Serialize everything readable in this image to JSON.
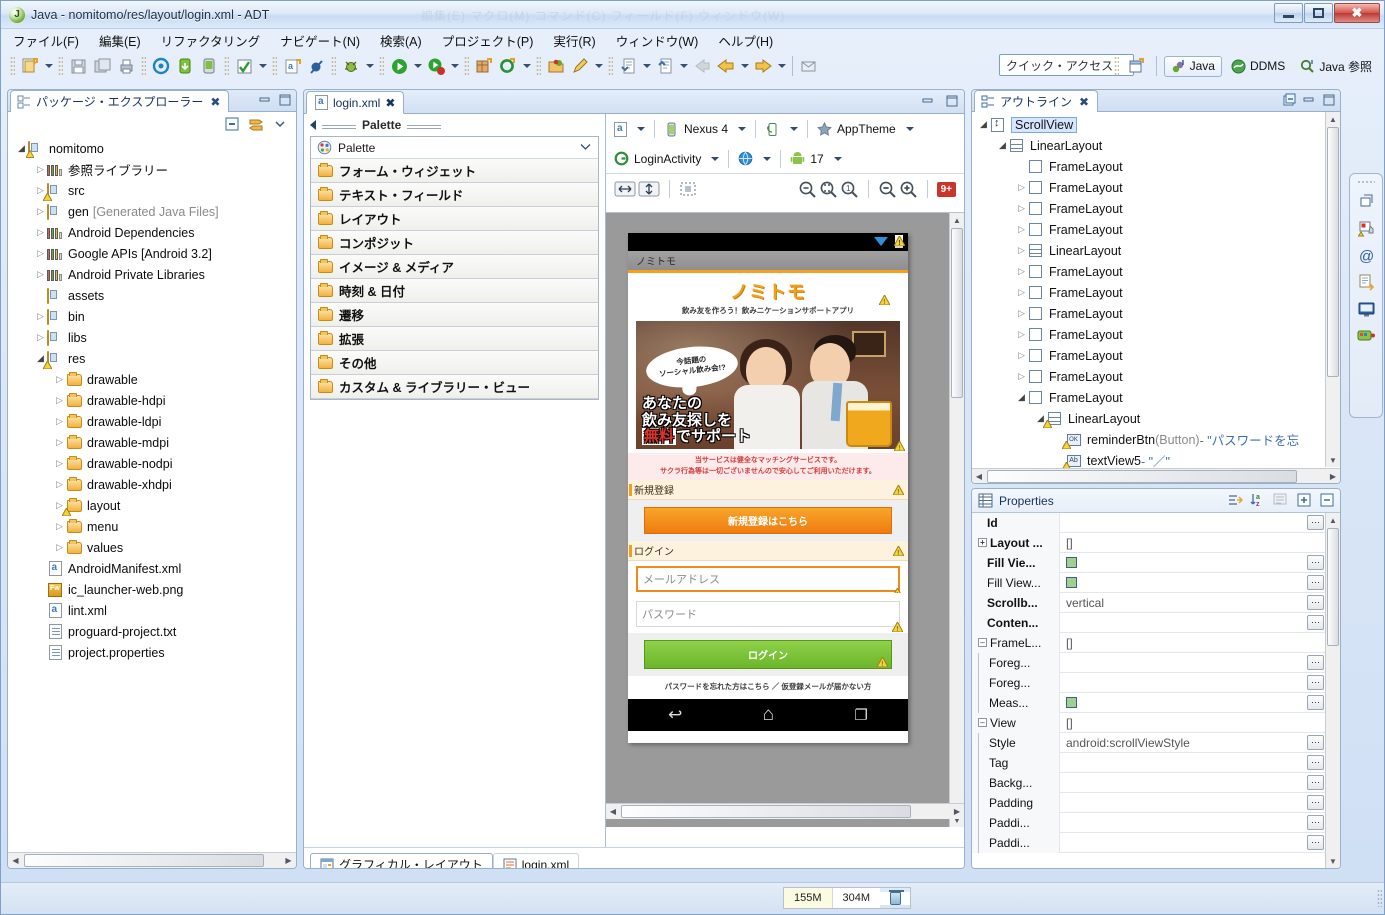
{
  "window": {
    "title": "Java - nomitomo/res/layout/login.xml - ADT",
    "ghost_text": "編集(E)    マクロ(M)    コマンド(C)    フィールド(F)    ウィンドウ(W)",
    "minimize": "–",
    "maximize": "□",
    "close": "✕"
  },
  "menubar": [
    {
      "label": "ファイル(F)"
    },
    {
      "label": "編集(E)"
    },
    {
      "label": "リファクタリング"
    },
    {
      "label": "ナビゲート(N)"
    },
    {
      "label": "検索(A)"
    },
    {
      "label": "プロジェクト(P)"
    },
    {
      "label": "実行(R)"
    },
    {
      "label": "ウィンドウ(W)"
    },
    {
      "label": "ヘルプ(H)"
    }
  ],
  "toolbar": {
    "quick_access_placeholder": "クイック・アクセス",
    "perspectives": [
      {
        "label": "Java",
        "active": true
      },
      {
        "label": "DDMS",
        "active": false
      },
      {
        "label": "Java 参照",
        "active": false
      }
    ]
  },
  "package_explorer": {
    "tab_label": "パッケージ・エクスプローラー",
    "close_glyph": "✖",
    "tree": [
      {
        "depth": 0,
        "label": "nomitomo",
        "icon": "project-icon",
        "twisty": "open",
        "warn": true
      },
      {
        "depth": 1,
        "label": "参照ライブラリー",
        "icon": "library-icon",
        "twisty": "closed"
      },
      {
        "depth": 1,
        "label": "src",
        "icon": "source-folder-icon",
        "twisty": "closed",
        "warn": true
      },
      {
        "depth": 1,
        "label": "gen",
        "suffix": "[Generated Java Files]",
        "icon": "source-folder-icon",
        "twisty": "closed"
      },
      {
        "depth": 1,
        "label": "Android Dependencies",
        "icon": "library-icon",
        "twisty": "closed"
      },
      {
        "depth": 1,
        "label": "Google APIs [Android 3.2]",
        "icon": "library-icon",
        "twisty": "closed"
      },
      {
        "depth": 1,
        "label": "Android Private Libraries",
        "icon": "library-icon",
        "twisty": "closed"
      },
      {
        "depth": 1,
        "label": "assets",
        "icon": "folder-res-icon",
        "twisty": "none"
      },
      {
        "depth": 1,
        "label": "bin",
        "icon": "folder-res-icon",
        "twisty": "closed"
      },
      {
        "depth": 1,
        "label": "libs",
        "icon": "folder-res-icon",
        "twisty": "closed"
      },
      {
        "depth": 1,
        "label": "res",
        "icon": "folder-res-icon",
        "twisty": "open",
        "warn": true
      },
      {
        "depth": 2,
        "label": "drawable",
        "icon": "folder-icon",
        "twisty": "closed"
      },
      {
        "depth": 2,
        "label": "drawable-hdpi",
        "icon": "folder-icon",
        "twisty": "closed"
      },
      {
        "depth": 2,
        "label": "drawable-ldpi",
        "icon": "folder-icon",
        "twisty": "closed"
      },
      {
        "depth": 2,
        "label": "drawable-mdpi",
        "icon": "folder-icon",
        "twisty": "closed"
      },
      {
        "depth": 2,
        "label": "drawable-nodpi",
        "icon": "folder-icon",
        "twisty": "closed"
      },
      {
        "depth": 2,
        "label": "drawable-xhdpi",
        "icon": "folder-icon",
        "twisty": "closed"
      },
      {
        "depth": 2,
        "label": "layout",
        "icon": "folder-icon",
        "twisty": "closed",
        "warn": true
      },
      {
        "depth": 2,
        "label": "menu",
        "icon": "folder-icon",
        "twisty": "closed"
      },
      {
        "depth": 2,
        "label": "values",
        "icon": "folder-icon",
        "twisty": "closed"
      },
      {
        "depth": 1,
        "label": "AndroidManifest.xml",
        "icon": "xml-file-icon",
        "twisty": "none"
      },
      {
        "depth": 1,
        "label": "ic_launcher-web.png",
        "icon": "png-file-icon",
        "twisty": "none"
      },
      {
        "depth": 1,
        "label": "lint.xml",
        "icon": "xml-file-icon",
        "twisty": "none"
      },
      {
        "depth": 1,
        "label": "proguard-project.txt",
        "icon": "text-file-icon",
        "twisty": "none"
      },
      {
        "depth": 1,
        "label": "project.properties",
        "icon": "text-file-icon",
        "twisty": "none"
      }
    ]
  },
  "editor": {
    "tab_label": "login.xml",
    "close_glyph": "✖",
    "palette": {
      "header_title": "Palette",
      "picker_label": "Palette",
      "categories": [
        {
          "label": "フォーム・ウィジェット"
        },
        {
          "label": "テキスト・フィールド"
        },
        {
          "label": "レイアウト"
        },
        {
          "label": "コンポジット"
        },
        {
          "label": "イメージ & メディア"
        },
        {
          "label": "時刻 & 日付"
        },
        {
          "label": "遷移"
        },
        {
          "label": "拡張"
        },
        {
          "label": "その他"
        },
        {
          "label": "カスタム & ライブラリー・ビュー"
        }
      ]
    },
    "config_bar": {
      "device": "Nexus 4",
      "theme": "AppTheme",
      "activity": "LoginActivity",
      "api_level": "17",
      "error_badge": "9+"
    },
    "bottom_tabs": [
      {
        "label": "グラフィカル・レイアウト",
        "active": true
      },
      {
        "label": "login.xml",
        "active": false
      }
    ]
  },
  "device_preview": {
    "app_title": "ノミトモ",
    "logo_text": "ノミトモ",
    "logo_sub": "飲み友を作ろう！飲みニケーションサポートアプリ",
    "hero_bubble": "今話題の\nソーシャル飲み会!?",
    "hero_line1": "あなたの",
    "hero_line2": "飲み友探しを",
    "hero_free": "無料",
    "hero_line3": "でサポート",
    "notice_line1": "当サービスは健全なマッチングサービスです。",
    "notice_line2": "サクラ行為等は一切ございませんので安心してご利用いただけます。",
    "section_register": "新規登録",
    "register_button": "新規登録はこちら",
    "section_login": "ログイン",
    "email_placeholder": "メールアドレス",
    "password_placeholder": "パスワード",
    "login_button": "ログイン",
    "footer_links": "パスワードを忘れた方はこちら ／ 仮登録メールが届かない方",
    "nav_back": "↩",
    "nav_home": "⌂",
    "nav_recent": "❐"
  },
  "outline": {
    "tab_label": "アウトライン",
    "close_glyph": "✖",
    "tree": [
      {
        "depth": 0,
        "label": "ScrollView",
        "icon": "scrollview-icon",
        "twisty": "open",
        "selected": true
      },
      {
        "depth": 1,
        "label": "LinearLayout",
        "icon": "linearlayout-icon",
        "twisty": "open"
      },
      {
        "depth": 2,
        "label": "FrameLayout",
        "icon": "framelayout-icon",
        "twisty": "none"
      },
      {
        "depth": 2,
        "label": "FrameLayout",
        "icon": "framelayout-icon",
        "twisty": "closed"
      },
      {
        "depth": 2,
        "label": "FrameLayout",
        "icon": "framelayout-icon",
        "twisty": "closed"
      },
      {
        "depth": 2,
        "label": "FrameLayout",
        "icon": "framelayout-icon",
        "twisty": "closed"
      },
      {
        "depth": 2,
        "label": "LinearLayout",
        "icon": "linearlayout-icon",
        "twisty": "closed"
      },
      {
        "depth": 2,
        "label": "FrameLayout",
        "icon": "framelayout-icon",
        "twisty": "closed"
      },
      {
        "depth": 2,
        "label": "FrameLayout",
        "icon": "framelayout-icon",
        "twisty": "closed"
      },
      {
        "depth": 2,
        "label": "FrameLayout",
        "icon": "framelayout-icon",
        "twisty": "closed"
      },
      {
        "depth": 2,
        "label": "FrameLayout",
        "icon": "framelayout-icon",
        "twisty": "closed"
      },
      {
        "depth": 2,
        "label": "FrameLayout",
        "icon": "framelayout-icon",
        "twisty": "closed"
      },
      {
        "depth": 2,
        "label": "FrameLayout",
        "icon": "framelayout-icon",
        "twisty": "closed"
      },
      {
        "depth": 2,
        "label": "FrameLayout",
        "icon": "framelayout-icon",
        "twisty": "open"
      },
      {
        "depth": 3,
        "label": "LinearLayout",
        "icon": "linearlayout-icon",
        "twisty": "open",
        "warn": true
      },
      {
        "depth": 4,
        "label": "reminderBtn",
        "type": "(Button)",
        "value": "\"パスワードを忘",
        "icon": "button-icon",
        "twisty": "none",
        "warn": true
      },
      {
        "depth": 4,
        "label": "textView5",
        "type": "",
        "value": "\"／\"",
        "icon": "textview-icon",
        "twisty": "none",
        "warn": true
      }
    ]
  },
  "properties": {
    "title": "Properties",
    "rows": [
      {
        "name": "Id",
        "value": "",
        "bold": true,
        "indent": 1,
        "hasbtn": true
      },
      {
        "name": "Layout ...",
        "value": "[]",
        "bold": true,
        "indent": 0,
        "expander": "+",
        "hasbtn": false
      },
      {
        "name": "Fill Vie...",
        "value": "",
        "bold": true,
        "indent": 1,
        "swatch": true,
        "hasbtn": true
      },
      {
        "name": "Fill View...",
        "value": "",
        "bold": false,
        "indent": 1,
        "swatch": true,
        "hasbtn": true
      },
      {
        "name": "Scrollb...",
        "value": "vertical",
        "bold": true,
        "indent": 1,
        "hasbtn": true
      },
      {
        "name": "Conten...",
        "value": "",
        "bold": true,
        "indent": 1,
        "hasbtn": true
      },
      {
        "name": "FrameL...",
        "value": "[]",
        "bold": false,
        "indent": 0,
        "expander": "–",
        "hasbtn": false
      },
      {
        "name": "Foreg...",
        "value": "",
        "bold": false,
        "indent": 2,
        "hasbtn": true
      },
      {
        "name": "Foreg...",
        "value": "",
        "bold": false,
        "indent": 2,
        "hasbtn": true
      },
      {
        "name": "Meas...",
        "value": "",
        "bold": false,
        "indent": 2,
        "swatch": true,
        "hasbtn": true
      },
      {
        "name": "View",
        "value": "[]",
        "bold": false,
        "indent": 0,
        "expander": "–",
        "hasbtn": false
      },
      {
        "name": "Style",
        "value": "android:scrollViewStyle",
        "bold": false,
        "indent": 2,
        "hasbtn": true
      },
      {
        "name": "Tag",
        "value": "",
        "bold": false,
        "indent": 2,
        "hasbtn": true
      },
      {
        "name": "Backg...",
        "value": "",
        "bold": false,
        "indent": 2,
        "hasbtn": true
      },
      {
        "name": "Padding",
        "value": "",
        "bold": false,
        "indent": 2,
        "hasbtn": true
      },
      {
        "name": "Paddi...",
        "value": "",
        "bold": false,
        "indent": 2,
        "hasbtn": true
      },
      {
        "name": "Paddi...",
        "value": "",
        "bold": false,
        "indent": 2,
        "hasbtn": true
      }
    ]
  },
  "status_bar": {
    "heap_used": "155M",
    "heap_sep": "/",
    "heap_total": "304M"
  }
}
